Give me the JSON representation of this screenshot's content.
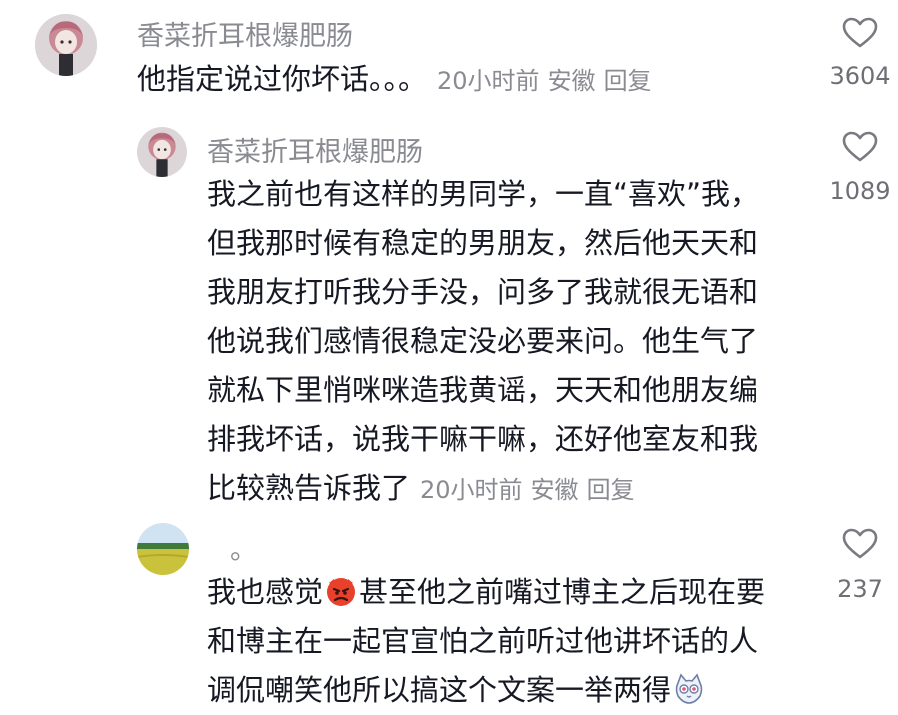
{
  "comments": [
    {
      "username": "香菜折耳根爆肥肠",
      "lines": [
        "他指定说过你坏话。。。"
      ],
      "time": "20小时前",
      "location": "安徽",
      "reply_label": "回复",
      "like_count": "3604",
      "avatar_icon": "anime-girl-avatar"
    },
    {
      "username": "香菜折耳根爆肥肠",
      "lines": [
        "我之前也有这样的男同学，一直“喜欢”我，",
        "但我那时候有稳定的男朋友，然后他天天和",
        "我朋友打听我分手没，问多了我就很无语和",
        "他说我们感情很稳定没必要来问。他生气了",
        "就私下里悄咪咪造我黄谣，天天和他朋友编",
        "排我坏话，说我干嘛干嘛，还好他室友和我",
        "比较熟告诉我了"
      ],
      "time": "20小时前",
      "location": "安徽",
      "reply_label": "回复",
      "like_count": "1089",
      "avatar_icon": "anime-girl-avatar"
    },
    {
      "username": "。",
      "line1_before": "我也感觉",
      "line1_after": "甚至他之前嘴过博主之后现在要",
      "line2": "和博主在一起官宣怕之前听过他讲坏话的人",
      "line3": "调侃嘲笑他所以搞这个文案一举两得",
      "like_count": "237",
      "avatar_icon": "field-landscape-avatar",
      "emoji_1": "angry-devil-emoji",
      "emoji_2": "cat-face-emoji"
    }
  ],
  "colors": {
    "primary_text": "#161823",
    "secondary_text": "#8a8b91",
    "background": "#ffffff"
  },
  "icons": {
    "like": "heart-outline-icon"
  }
}
